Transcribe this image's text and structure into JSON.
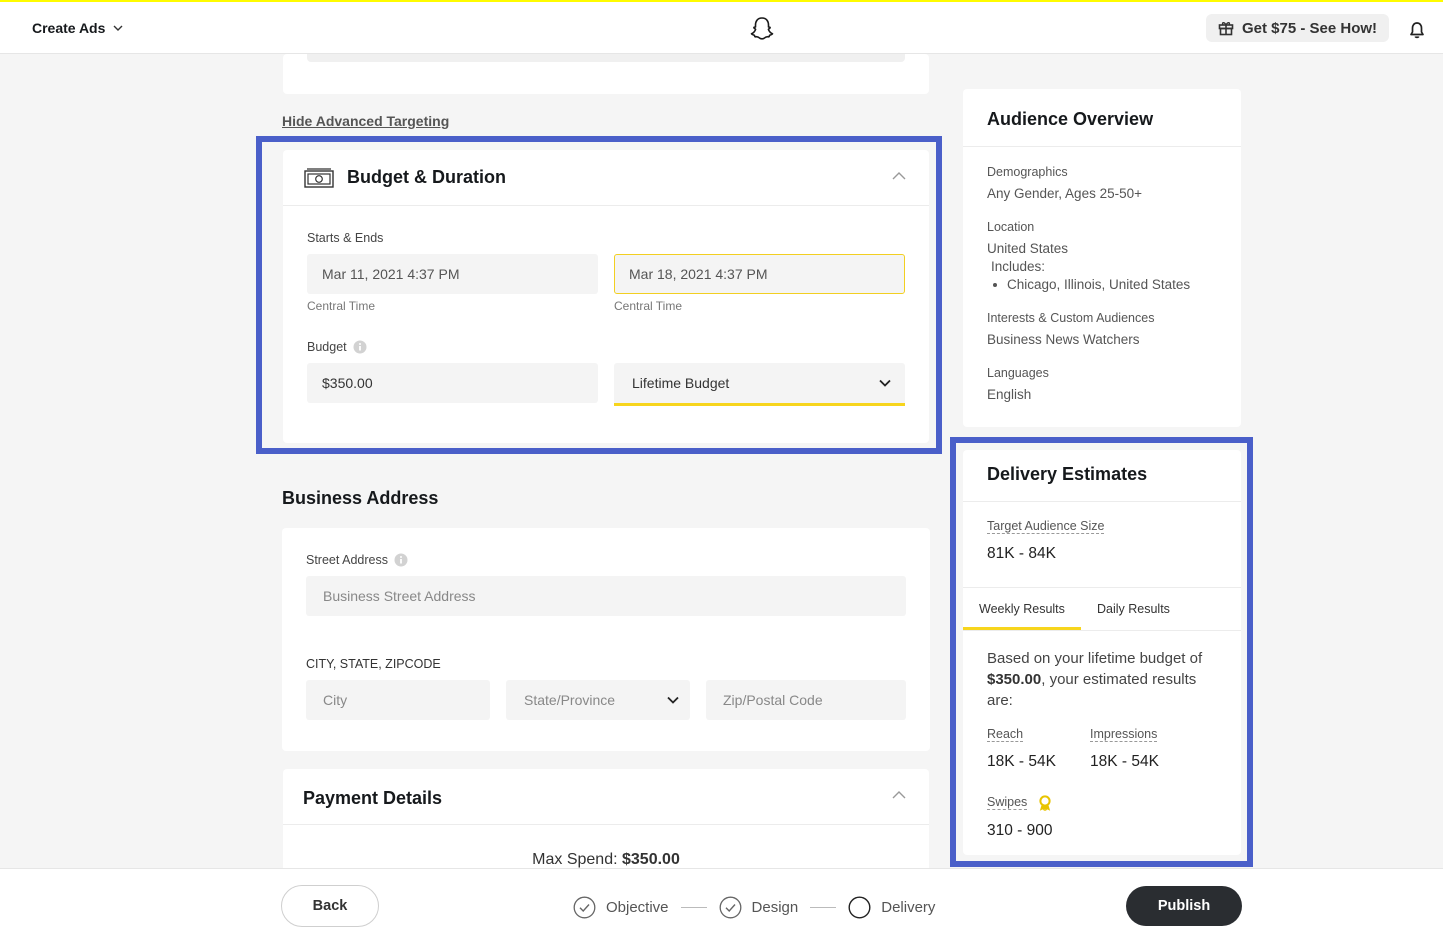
{
  "header": {
    "create_ads_label": "Create Ads",
    "promo_label": "Get $75 - See How!"
  },
  "advanced": {
    "hide_link": "Hide Advanced Targeting"
  },
  "budget_section": {
    "title": "Budget & Duration",
    "dates_label": "Starts & Ends",
    "start_value": "Mar 11, 2021 4:37 PM",
    "start_tz": "Central Time",
    "end_value": "Mar 18, 2021 4:37 PM",
    "end_tz": "Central Time",
    "budget_label": "Budget",
    "budget_value": "$350.00",
    "budget_type_selected": "Lifetime Budget"
  },
  "business_address": {
    "title": "Business Address",
    "street_label": "Street Address",
    "street_placeholder": "Business Street Address",
    "csz_label": "CITY, STATE, ZIPCODE",
    "city_placeholder": "City",
    "state_placeholder": "State/Province",
    "zip_placeholder": "Zip/Postal Code"
  },
  "payment": {
    "title": "Payment Details",
    "max_spend_label": "Max Spend:",
    "max_spend_value": "$350.00"
  },
  "audience_overview": {
    "title": "Audience Overview",
    "demographics_label": "Demographics",
    "demographics_value": "Any Gender, Ages 25-50+",
    "location_label": "Location",
    "location_value": "United States",
    "includes_label": "Includes:",
    "includes_items": [
      "Chicago, Illinois, United States"
    ],
    "interests_label": "Interests & Custom Audiences",
    "interests_value": "Business News Watchers",
    "languages_label": "Languages",
    "languages_value": "English"
  },
  "delivery_estimates": {
    "title": "Delivery Estimates",
    "audience_size_label": "Target Audience Size",
    "audience_size_value": "81K - 84K",
    "tabs": [
      "Weekly Results",
      "Daily Results"
    ],
    "active_tab": "Weekly Results",
    "desc_prefix": "Based on your lifetime budget of",
    "desc_amount": "$350.00",
    "desc_suffix": ", your estimated results are:",
    "reach_label": "Reach",
    "reach_value": "18K - 54K",
    "impressions_label": "Impressions",
    "impressions_value": "18K - 54K",
    "swipes_label": "Swipes",
    "swipes_value": "310 - 900"
  },
  "footer": {
    "back_label": "Back",
    "steps": [
      {
        "label": "Objective",
        "state": "done"
      },
      {
        "label": "Design",
        "state": "done"
      },
      {
        "label": "Delivery",
        "state": "current"
      }
    ],
    "publish_label": "Publish"
  },
  "colors": {
    "accent_yellow": "#f7d51d",
    "highlight_blue": "#4a5fc9",
    "publish_bg": "#2a2d31"
  },
  "icons": [
    "chevron-down-icon",
    "snapchat-ghost-icon",
    "gift-icon",
    "bell-icon",
    "money-icon",
    "chevron-up-icon",
    "info-icon",
    "award-icon",
    "check-circle-icon",
    "empty-circle-icon"
  ]
}
